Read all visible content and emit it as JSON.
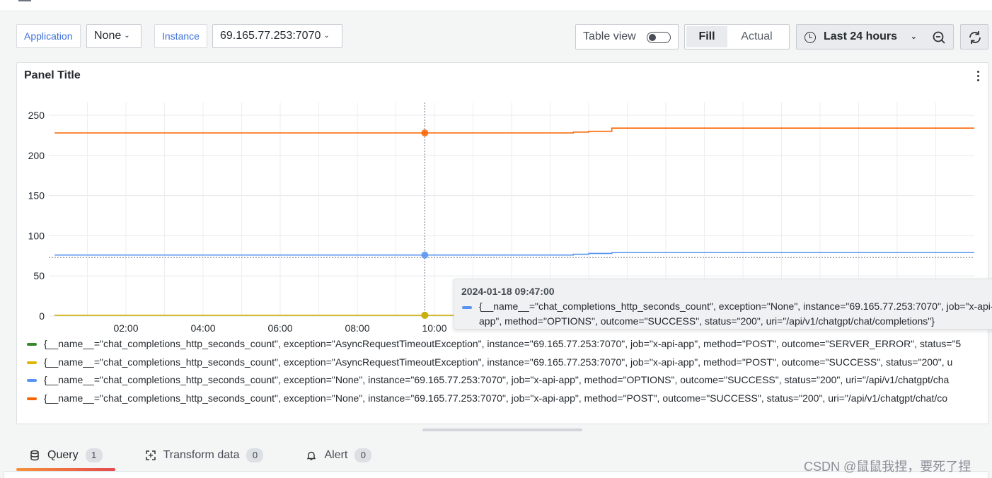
{
  "variables": [
    {
      "label": "Application",
      "value": "None"
    },
    {
      "label": "Instance",
      "value": "69.165.77.253:7070"
    }
  ],
  "toolbar": {
    "table_view_label": "Table view",
    "table_view_on": false,
    "fill_label": "Fill",
    "actual_label": "Actual",
    "time_range_label": "Last 24 hours"
  },
  "panel": {
    "title": "Panel Title"
  },
  "chart_data": {
    "type": "line",
    "title": "Panel Title",
    "x_ticks": [
      "02:00",
      "04:00",
      "06:00",
      "08:00",
      "10:00"
    ],
    "y_ticks": [
      "0",
      "50",
      "100",
      "150",
      "200",
      "250"
    ],
    "ylim": [
      0,
      250
    ],
    "grid": true,
    "legend_position": "bottom",
    "x_hours": [
      0.15,
      5.87,
      9.75,
      13.6,
      13.9,
      14.0,
      14.6,
      24.0
    ],
    "series": [
      {
        "name": "{__name__=\"chat_completions_http_seconds_count\", exception=\"AsyncRequestTimeoutException\", instance=\"69.165.77.253:7070\", job=\"x-api-app\", method=\"POST\", outcome=\"SERVER_ERROR\", status=\"5",
        "color": "#37872d",
        "values": [
          1,
          1,
          1,
          1,
          1,
          1,
          1,
          1
        ]
      },
      {
        "name": "{__name__=\"chat_completions_http_seconds_count\", exception=\"AsyncRequestTimeoutException\", instance=\"69.165.77.253:7070\", job=\"x-api-app\", method=\"POST\", outcome=\"SUCCESS\", status=\"200\", u",
        "color": "#e0b400",
        "values": [
          1,
          1,
          1,
          1,
          1,
          1,
          1,
          1
        ]
      },
      {
        "name": "{__name__=\"chat_completions_http_seconds_count\", exception=\"None\", instance=\"69.165.77.253:7070\", job=\"x-api-app\", method=\"OPTIONS\", outcome=\"SUCCESS\", status=\"200\", uri=\"/api/v1/chatgpt/cha",
        "color": "#5794f2",
        "values": [
          76,
          76,
          76,
          77,
          77,
          78,
          79,
          79
        ]
      },
      {
        "name": "{__name__=\"chat_completions_http_seconds_count\", exception=\"None\", instance=\"69.165.77.253:7070\", job=\"x-api-app\", method=\"POST\", outcome=\"SUCCESS\", status=\"200\", uri=\"/api/v1/chatgpt/chat/co",
        "color": "#fa6400",
        "values": [
          228,
          228,
          228,
          229,
          229,
          230,
          234,
          234
        ]
      }
    ],
    "cursor_hour": 9.75,
    "threshold_dashed": 73
  },
  "tooltip": {
    "time": "2024-01-18 09:47:00",
    "text": "{__name__=\"chat_completions_http_seconds_count\", exception=\"None\", instance=\"69.165.77.253:7070\", job=\"x-api-app\", method=\"OPTIONS\", outcome=\"SUCCESS\", status=\"200\", uri=\"/api/v1/chatgpt/chat/completions\"}",
    "series_color": "#5794f2"
  },
  "tabs": [
    {
      "label": "Query",
      "count": "1",
      "icon": "database-icon"
    },
    {
      "label": "Transform data",
      "count": "0",
      "icon": "transform-icon"
    },
    {
      "label": "Alert",
      "count": "0",
      "icon": "bell-icon"
    }
  ],
  "watermark": "CSDN @鼠鼠我捏，要死了捏"
}
